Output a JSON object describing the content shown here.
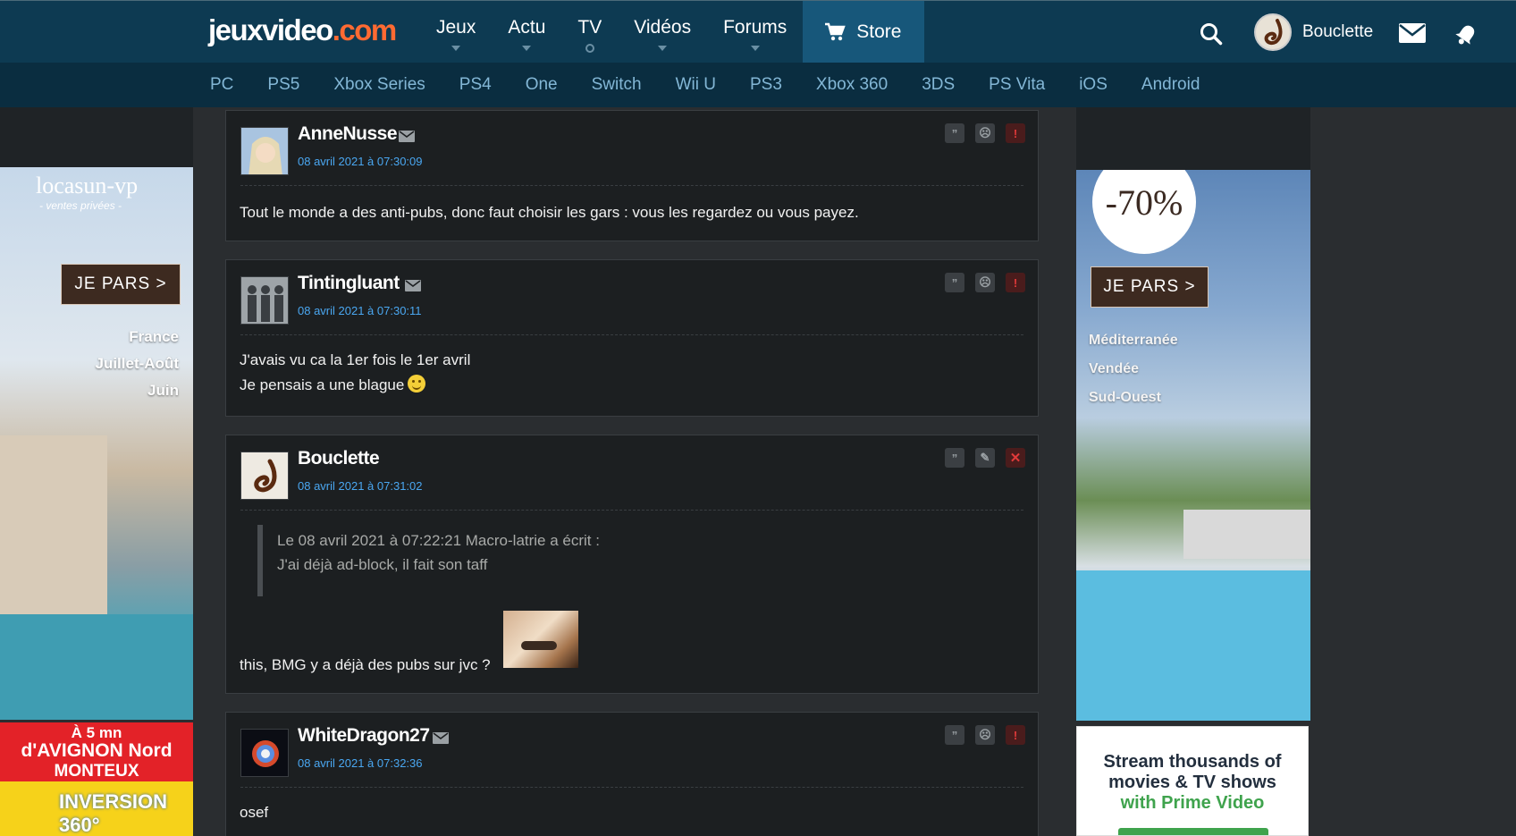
{
  "header": {
    "logo_left": "jeuxvideo",
    "logo_right": ".com",
    "nav": [
      {
        "label": "Jeux",
        "marker": "caret"
      },
      {
        "label": "Actu",
        "marker": "caret"
      },
      {
        "label": "TV",
        "marker": "dot"
      },
      {
        "label": "Vidéos",
        "marker": "caret"
      },
      {
        "label": "Forums",
        "marker": "caret"
      }
    ],
    "store_label": "Store",
    "username": "Bouclette",
    "icons": [
      "search-icon",
      "cart-icon",
      "mail-icon",
      "notification-bell-icon"
    ],
    "colors": {
      "header_bg": "#0d3a52",
      "subnav_bg": "#0a2d40",
      "logo_accent": "#ff6a32",
      "link_blue": "#4aa7f1"
    }
  },
  "platforms": [
    "PC",
    "PS5",
    "Xbox Series",
    "PS4",
    "One",
    "Switch",
    "Wii U",
    "PS3",
    "Xbox 360",
    "3DS",
    "PS Vita",
    "iOS",
    "Android"
  ],
  "ads": {
    "left": {
      "brand": "locasun-vp",
      "tagline": "- ventes privées -",
      "cta": "JE PARS >",
      "locations": [
        "France",
        "Juillet-Août",
        "Juin"
      ]
    },
    "left2": {
      "line1": "À 5 mn",
      "line2": "d'AVIGNON Nord",
      "line3": "MONTEUX",
      "line4": "INVERSION 360°"
    },
    "right": {
      "discount": "-70%",
      "cta": "JE PARS >",
      "locations": [
        "Méditerranée",
        "Vendée",
        "Sud-Ouest"
      ]
    },
    "right2": {
      "line1": "Stream thousands of",
      "line2": "movies & TV shows",
      "line3": "with Prime Video"
    }
  },
  "posts": [
    {
      "author": "AnneNusse",
      "date": "08 avril 2021 à 07:30:09",
      "lines": [
        "Tout le monde a des anti-pubs, donc faut choisir les gars : vous les regardez ou vous payez."
      ],
      "actions": [
        "quote",
        "report-user",
        "alert"
      ]
    },
    {
      "author": "Tintingluant",
      "date": "08 avril 2021 à 07:30:11",
      "lines": [
        "J'avais vu ca la 1er fois le 1er avril",
        "Je pensais a une blague"
      ],
      "actions": [
        "quote",
        "report-user",
        "alert"
      ]
    },
    {
      "author": "Bouclette",
      "date": "08 avril 2021 à 07:31:02",
      "quote": [
        "Le 08 avril 2021 à 07:22:21 Macro-latrie a écrit :",
        "J'ai déjà ad-block, il fait son taff"
      ],
      "lines": [
        "this, BMG y a déjà des pubs sur jvc ?"
      ],
      "actions": [
        "quote",
        "edit",
        "delete"
      ]
    },
    {
      "author": "WhiteDragon27",
      "date": "08 avril 2021 à 07:32:36",
      "lines": [
        "osef"
      ],
      "actions": [
        "quote",
        "report-user",
        "alert"
      ]
    }
  ]
}
